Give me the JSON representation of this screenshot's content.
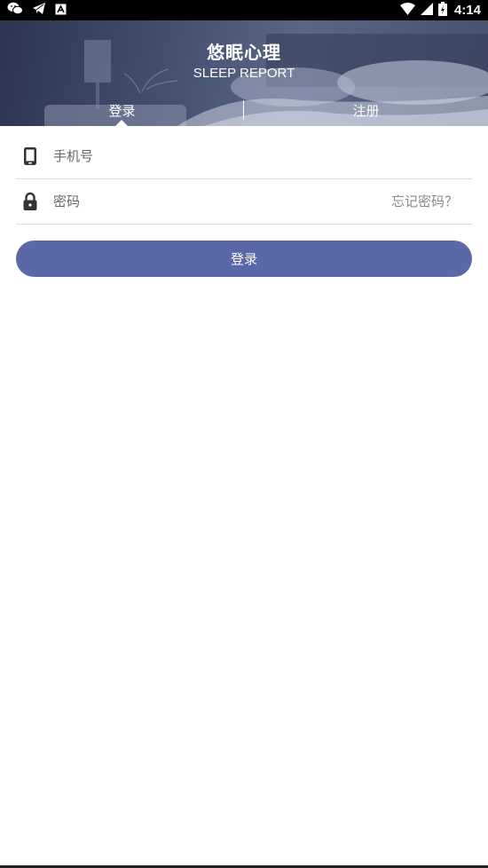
{
  "status_bar": {
    "time": "4:14",
    "icons": [
      "wechat-icon",
      "telegram-icon",
      "notification-a-icon",
      "wifi-icon",
      "cell-signal-icon",
      "battery-icon"
    ]
  },
  "header": {
    "title": "悠眠心理",
    "subtitle": "SLEEP REPORT",
    "tabs": [
      {
        "label": "登录",
        "active": true
      },
      {
        "label": "注册",
        "active": false
      }
    ]
  },
  "form": {
    "phone": {
      "placeholder": "手机号",
      "value": "",
      "icon": "phone-icon"
    },
    "password": {
      "placeholder": "密码",
      "value": "",
      "icon": "lock-icon",
      "forgot_label": "忘记密码？"
    },
    "submit_label": "登录"
  },
  "colors": {
    "accent": "#5b68a8",
    "header_bg": "#44506f",
    "divider": "#dddddd"
  }
}
